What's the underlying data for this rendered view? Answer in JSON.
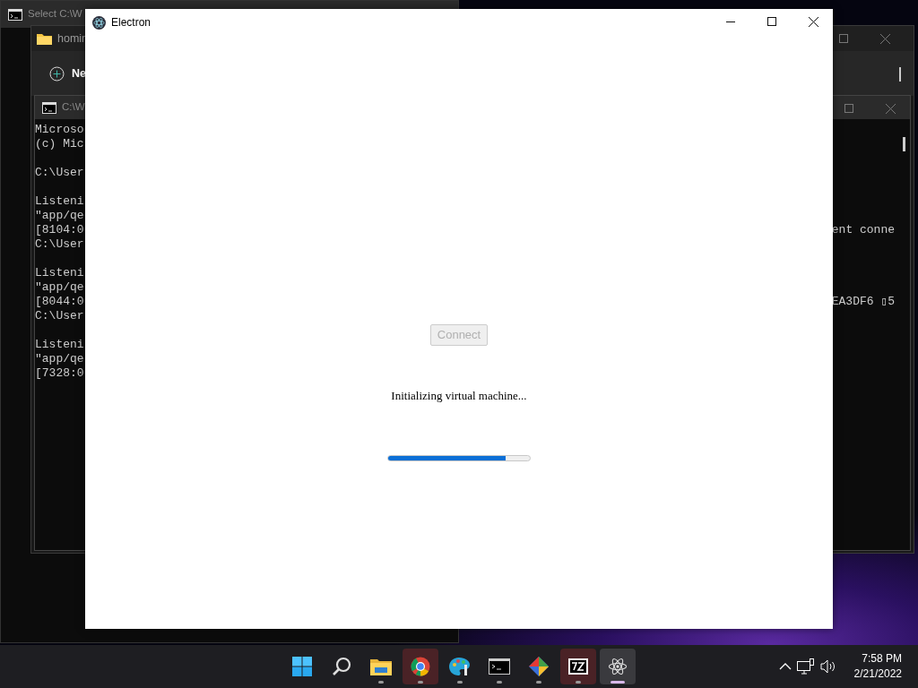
{
  "console_window_back": {
    "title": "Select C:\\W"
  },
  "explorer_window": {
    "tab_label": "homin",
    "new_button": "Ne"
  },
  "console_window": {
    "title": "C:\\W",
    "blocks": [
      [
        {
          "text": "Microso"
        },
        {
          "text": "(c) Mic"
        }
      ],
      [
        {
          "text": "C:\\User"
        }
      ],
      [
        {
          "text": "Listeni"
        },
        {
          "text": "\"app/qe"
        },
        {
          "text": "[8104:0",
          "trailing": "ent conne"
        },
        {
          "text": "C:\\User"
        }
      ],
      [
        {
          "text": "Listeni"
        },
        {
          "text": "\"app/qe"
        },
        {
          "text": "[8044:0",
          "trailing": "EA3DF6 ▯5"
        },
        {
          "text": "C:\\User"
        }
      ],
      [
        {
          "text": "Listeni"
        },
        {
          "text": "\"app/qe"
        },
        {
          "text": "[7328:0"
        }
      ]
    ]
  },
  "app_window": {
    "title": "Electron",
    "connect_button": {
      "label": "Connect",
      "disabled": true
    },
    "status": "Initializing virtual machine...",
    "progress": {
      "level": 0.83
    }
  },
  "taskbar": {
    "apps": [
      {
        "kind": "start",
        "running": false,
        "selected": false,
        "flashing": false
      },
      {
        "kind": "search",
        "running": false,
        "selected": false,
        "flashing": false
      },
      {
        "kind": "explorer",
        "running": true,
        "selected": false,
        "flashing": false
      },
      {
        "kind": "chrome",
        "running": true,
        "selected": false,
        "flashing": true
      },
      {
        "kind": "paint",
        "running": true,
        "selected": false,
        "flashing": false
      },
      {
        "kind": "terminal",
        "running": true,
        "selected": false,
        "flashing": false
      },
      {
        "kind": "git",
        "running": true,
        "selected": false,
        "flashing": false
      },
      {
        "kind": "archiver",
        "running": true,
        "selected": false,
        "flashing": true
      },
      {
        "kind": "electron",
        "running": true,
        "selected": true,
        "flashing": false
      }
    ],
    "tray": {
      "time": "7:58 PM",
      "date": "2/21/2022"
    }
  }
}
